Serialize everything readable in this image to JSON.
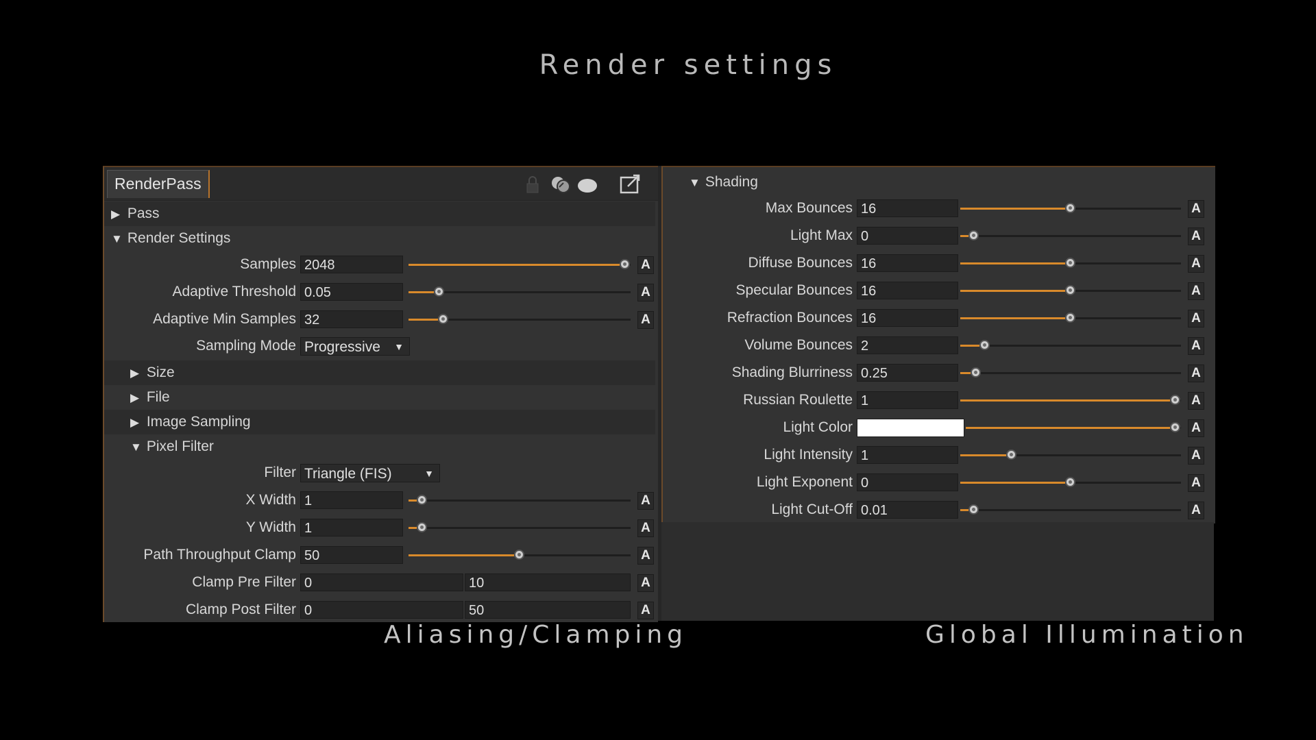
{
  "slide": {
    "title": "Render settings",
    "caption_left": "Aliasing/Clamping",
    "caption_right": "Global Illumination"
  },
  "left_panel": {
    "tab": "RenderPass",
    "toolbar_icons": [
      "lock-icon",
      "spheres-icon",
      "ellipse-icon",
      "pop-out-icon"
    ],
    "sections": {
      "pass": "Pass",
      "render_settings": "Render Settings",
      "size": "Size",
      "file": "File",
      "image_sampling": "Image Sampling",
      "pixel_filter": "Pixel Filter"
    },
    "samples": {
      "label": "Samples",
      "value": "2048",
      "slider": 1.0
    },
    "adaptive_threshold": {
      "label": "Adaptive Threshold",
      "value": "0.05",
      "slider": 0.12
    },
    "adaptive_min_samples": {
      "label": "Adaptive Min Samples",
      "value": "32",
      "slider": 0.14
    },
    "sampling_mode": {
      "label": "Sampling Mode",
      "value": "Progressive"
    },
    "filter": {
      "label": "Filter",
      "value": "Triangle (FIS)"
    },
    "x_width": {
      "label": "X Width",
      "value": "1",
      "slider": 0.04
    },
    "y_width": {
      "label": "Y Width",
      "value": "1",
      "slider": 0.04
    },
    "path_throughput_clamp": {
      "label": "Path Throughput Clamp",
      "value": "50",
      "slider": 0.5
    },
    "clamp_pre_filter": {
      "label": "Clamp Pre Filter",
      "value_a": "0",
      "value_b": "10"
    },
    "clamp_post_filter": {
      "label": "Clamp Post Filter",
      "value_a": "0",
      "value_b": "50"
    },
    "auto_button": "A"
  },
  "right_panel": {
    "section": "Shading",
    "auto_button": "A",
    "rows": [
      {
        "label": "Max Bounces",
        "value": "16",
        "slider": 0.5
      },
      {
        "label": "Light Max",
        "value": "0",
        "slider": 0.04
      },
      {
        "label": "Diffuse Bounces",
        "value": "16",
        "slider": 0.5
      },
      {
        "label": "Specular Bounces",
        "value": "16",
        "slider": 0.5
      },
      {
        "label": "Refraction Bounces",
        "value": "16",
        "slider": 0.5
      },
      {
        "label": "Volume Bounces",
        "value": "2",
        "slider": 0.09
      },
      {
        "label": "Shading Blurriness",
        "value": "0.25",
        "slider": 0.05
      },
      {
        "label": "Russian Roulette",
        "value": "1",
        "slider": 1.0
      },
      {
        "label": "Light Color",
        "value": "",
        "slider": 1.0,
        "color": "#ffffff"
      },
      {
        "label": "Light Intensity",
        "value": "1",
        "slider": 0.22
      },
      {
        "label": "Light Exponent",
        "value": "0",
        "slider": 0.5
      },
      {
        "label": "Light Cut-Off",
        "value": "0.01",
        "slider": 0.04
      }
    ]
  },
  "colors": {
    "accent": "#d98a2b",
    "panel_bg": "#333333",
    "field_bg": "#262626"
  }
}
